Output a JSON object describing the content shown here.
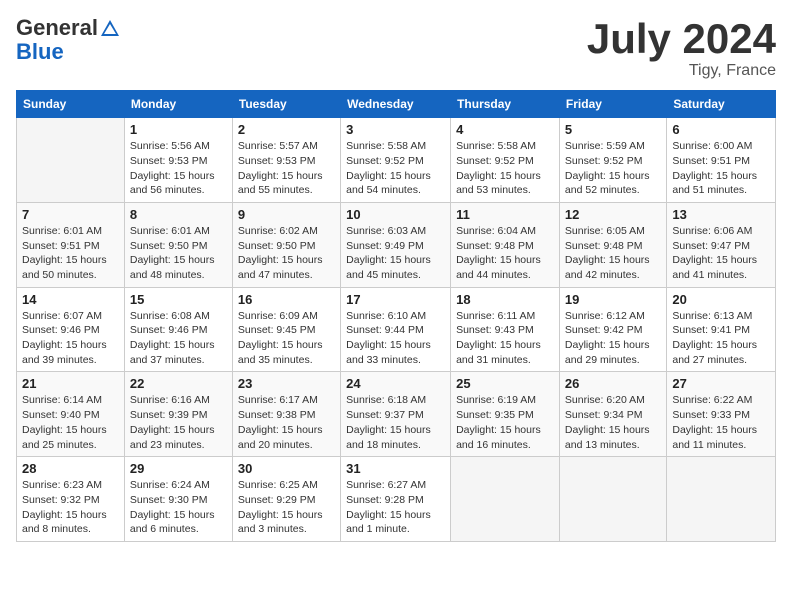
{
  "header": {
    "logo_line1": "General",
    "logo_line2": "Blue",
    "title": "July 2024",
    "location": "Tigy, France"
  },
  "columns": [
    "Sunday",
    "Monday",
    "Tuesday",
    "Wednesday",
    "Thursday",
    "Friday",
    "Saturday"
  ],
  "weeks": [
    [
      {
        "num": "",
        "info": ""
      },
      {
        "num": "1",
        "info": "Sunrise: 5:56 AM\nSunset: 9:53 PM\nDaylight: 15 hours\nand 56 minutes."
      },
      {
        "num": "2",
        "info": "Sunrise: 5:57 AM\nSunset: 9:53 PM\nDaylight: 15 hours\nand 55 minutes."
      },
      {
        "num": "3",
        "info": "Sunrise: 5:58 AM\nSunset: 9:52 PM\nDaylight: 15 hours\nand 54 minutes."
      },
      {
        "num": "4",
        "info": "Sunrise: 5:58 AM\nSunset: 9:52 PM\nDaylight: 15 hours\nand 53 minutes."
      },
      {
        "num": "5",
        "info": "Sunrise: 5:59 AM\nSunset: 9:52 PM\nDaylight: 15 hours\nand 52 minutes."
      },
      {
        "num": "6",
        "info": "Sunrise: 6:00 AM\nSunset: 9:51 PM\nDaylight: 15 hours\nand 51 minutes."
      }
    ],
    [
      {
        "num": "7",
        "info": "Sunrise: 6:01 AM\nSunset: 9:51 PM\nDaylight: 15 hours\nand 50 minutes."
      },
      {
        "num": "8",
        "info": "Sunrise: 6:01 AM\nSunset: 9:50 PM\nDaylight: 15 hours\nand 48 minutes."
      },
      {
        "num": "9",
        "info": "Sunrise: 6:02 AM\nSunset: 9:50 PM\nDaylight: 15 hours\nand 47 minutes."
      },
      {
        "num": "10",
        "info": "Sunrise: 6:03 AM\nSunset: 9:49 PM\nDaylight: 15 hours\nand 45 minutes."
      },
      {
        "num": "11",
        "info": "Sunrise: 6:04 AM\nSunset: 9:48 PM\nDaylight: 15 hours\nand 44 minutes."
      },
      {
        "num": "12",
        "info": "Sunrise: 6:05 AM\nSunset: 9:48 PM\nDaylight: 15 hours\nand 42 minutes."
      },
      {
        "num": "13",
        "info": "Sunrise: 6:06 AM\nSunset: 9:47 PM\nDaylight: 15 hours\nand 41 minutes."
      }
    ],
    [
      {
        "num": "14",
        "info": "Sunrise: 6:07 AM\nSunset: 9:46 PM\nDaylight: 15 hours\nand 39 minutes."
      },
      {
        "num": "15",
        "info": "Sunrise: 6:08 AM\nSunset: 9:46 PM\nDaylight: 15 hours\nand 37 minutes."
      },
      {
        "num": "16",
        "info": "Sunrise: 6:09 AM\nSunset: 9:45 PM\nDaylight: 15 hours\nand 35 minutes."
      },
      {
        "num": "17",
        "info": "Sunrise: 6:10 AM\nSunset: 9:44 PM\nDaylight: 15 hours\nand 33 minutes."
      },
      {
        "num": "18",
        "info": "Sunrise: 6:11 AM\nSunset: 9:43 PM\nDaylight: 15 hours\nand 31 minutes."
      },
      {
        "num": "19",
        "info": "Sunrise: 6:12 AM\nSunset: 9:42 PM\nDaylight: 15 hours\nand 29 minutes."
      },
      {
        "num": "20",
        "info": "Sunrise: 6:13 AM\nSunset: 9:41 PM\nDaylight: 15 hours\nand 27 minutes."
      }
    ],
    [
      {
        "num": "21",
        "info": "Sunrise: 6:14 AM\nSunset: 9:40 PM\nDaylight: 15 hours\nand 25 minutes."
      },
      {
        "num": "22",
        "info": "Sunrise: 6:16 AM\nSunset: 9:39 PM\nDaylight: 15 hours\nand 23 minutes."
      },
      {
        "num": "23",
        "info": "Sunrise: 6:17 AM\nSunset: 9:38 PM\nDaylight: 15 hours\nand 20 minutes."
      },
      {
        "num": "24",
        "info": "Sunrise: 6:18 AM\nSunset: 9:37 PM\nDaylight: 15 hours\nand 18 minutes."
      },
      {
        "num": "25",
        "info": "Sunrise: 6:19 AM\nSunset: 9:35 PM\nDaylight: 15 hours\nand 16 minutes."
      },
      {
        "num": "26",
        "info": "Sunrise: 6:20 AM\nSunset: 9:34 PM\nDaylight: 15 hours\nand 13 minutes."
      },
      {
        "num": "27",
        "info": "Sunrise: 6:22 AM\nSunset: 9:33 PM\nDaylight: 15 hours\nand 11 minutes."
      }
    ],
    [
      {
        "num": "28",
        "info": "Sunrise: 6:23 AM\nSunset: 9:32 PM\nDaylight: 15 hours\nand 8 minutes."
      },
      {
        "num": "29",
        "info": "Sunrise: 6:24 AM\nSunset: 9:30 PM\nDaylight: 15 hours\nand 6 minutes."
      },
      {
        "num": "30",
        "info": "Sunrise: 6:25 AM\nSunset: 9:29 PM\nDaylight: 15 hours\nand 3 minutes."
      },
      {
        "num": "31",
        "info": "Sunrise: 6:27 AM\nSunset: 9:28 PM\nDaylight: 15 hours\nand 1 minute."
      },
      {
        "num": "",
        "info": ""
      },
      {
        "num": "",
        "info": ""
      },
      {
        "num": "",
        "info": ""
      }
    ]
  ]
}
